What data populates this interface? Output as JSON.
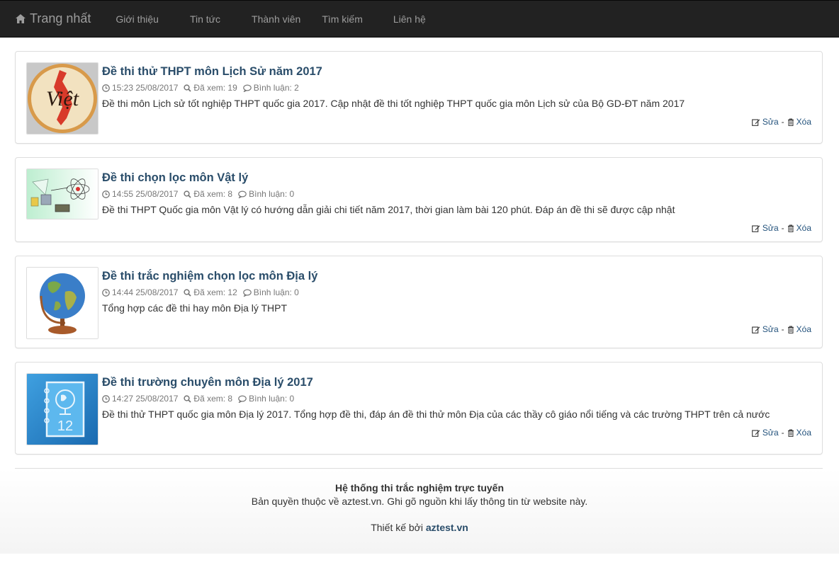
{
  "nav": {
    "brand": "Trang nhất",
    "items": [
      "Giới thiệu",
      "Tin tức",
      "Thành viên",
      "Tìm kiếm",
      "Liên hệ"
    ]
  },
  "posts": [
    {
      "title": "Đề thi thử THPT môn Lịch Sử năm 2017",
      "time": "15:23 25/08/2017",
      "views": "Đã xem: 19",
      "comments": "Bình luận: 2",
      "desc": "Đề thi môn Lịch sử tốt nghiệp THPT quốc gia 2017. Cập nhật đề thi tốt nghiệp THPT quốc gia môn Lịch sử của Bộ GD-ĐT năm 2017",
      "thumb_text": "Việt"
    },
    {
      "title": "Đề thi chọn lọc môn Vật lý",
      "time": "14:55 25/08/2017",
      "views": "Đã xem: 8",
      "comments": "Bình luận: 0",
      "desc": "Đề thi THPT Quốc gia môn Vật lý có hướng dẫn giải chi tiết năm 2017, thời gian làm bài 120 phút. Đáp án đề thi sẽ được cập nhật"
    },
    {
      "title": "Đề thi trắc nghiệm chọn lọc môn Địa lý",
      "time": "14:44 25/08/2017",
      "views": "Đã xem: 12",
      "comments": "Bình luận: 0",
      "desc": "Tổng hợp các đề thi hay môn Địa lý THPT"
    },
    {
      "title": "Đề thi trường chuyên môn Địa lý 2017",
      "time": "14:27 25/08/2017",
      "views": "Đã xem: 8",
      "comments": "Bình luận: 0",
      "desc": "Đề thi thử THPT quốc gia môn Địa lý 2017. Tổng hợp đề thi, đáp án đề thi thử môn Địa của các thầy cô giáo nổi tiếng và các trường THPT trên cả nước",
      "thumb_text": "12"
    }
  ],
  "actions": {
    "edit": "Sửa",
    "sep": "-",
    "delete": "Xóa"
  },
  "footer": {
    "title": "Hệ thống thi trắc nghiệm trực tuyến",
    "copyright": "Bản quyền thuộc về aztest.vn. Ghi gõ nguồn khi lấy thông tin từ website này.",
    "design_prefix": "Thiết kế bởi",
    "design_site": "aztest.vn"
  },
  "colors": {
    "navbar": "#222222",
    "link": "#2a4d6a",
    "meta": "#777777"
  }
}
